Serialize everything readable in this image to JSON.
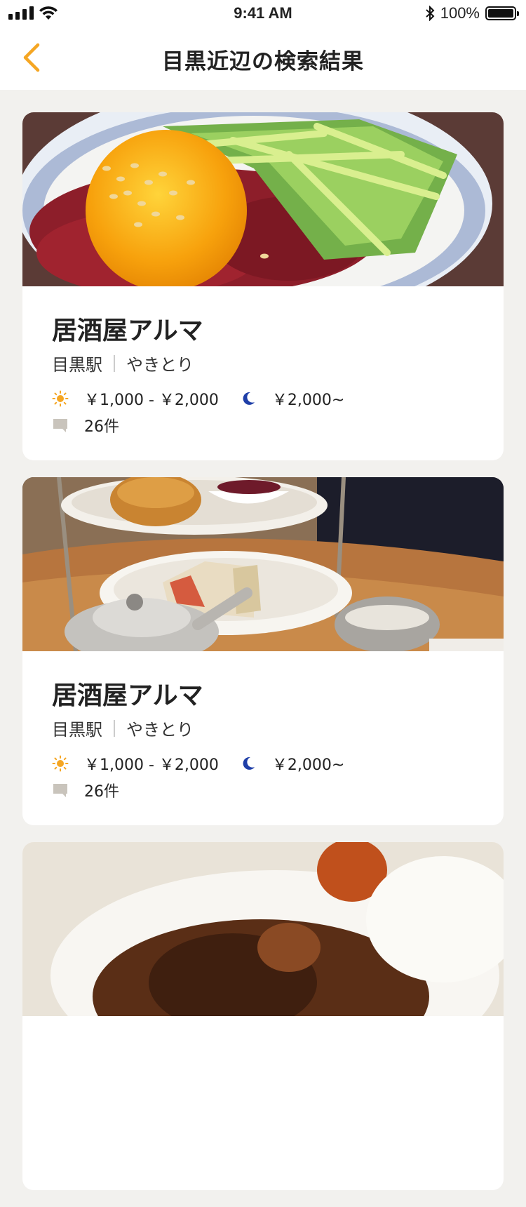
{
  "status_bar": {
    "time": "9:41 AM",
    "battery": "100%"
  },
  "nav": {
    "title": "目黒近辺の検索結果",
    "back_icon": "chevron-left-icon"
  },
  "colors": {
    "accent": "#F5A623",
    "moon": "#1F3FA8",
    "background": "#F2F1EE"
  },
  "results": [
    {
      "name": "居酒屋アルマ",
      "station": "目黒駅",
      "genre": "やきとり",
      "lunch_price": "￥1,000 - ￥2,000",
      "dinner_price": "￥2,000~",
      "reviews": "26件",
      "image": "yukhoe-egg-yolk-photo"
    },
    {
      "name": "居酒屋アルマ",
      "station": "目黒駅",
      "genre": "やきとり",
      "lunch_price": "￥1,000 - ￥2,000",
      "dinner_price": "￥2,000~",
      "reviews": "26件",
      "image": "afternoon-tea-stand-photo"
    },
    {
      "image": "curry-rice-photo"
    }
  ]
}
